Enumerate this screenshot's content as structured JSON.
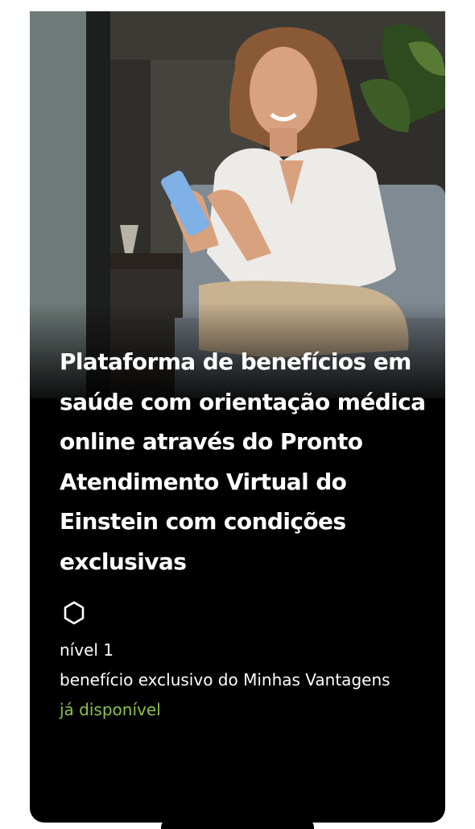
{
  "card": {
    "title": "Plataforma de benefícios em saúde com orientação médica online através do Pronto Atendimento Virtual do Einstein com condições exclusivas",
    "tier_icon": "hexagon-icon",
    "level": "nível 1",
    "exclusive_text": "benefício exclusivo do Minhas Vantagens",
    "availability": "já disponível"
  },
  "colors": {
    "card_background": "#000000",
    "title_text": "#ffffff",
    "availability_text": "#8bc34a"
  }
}
